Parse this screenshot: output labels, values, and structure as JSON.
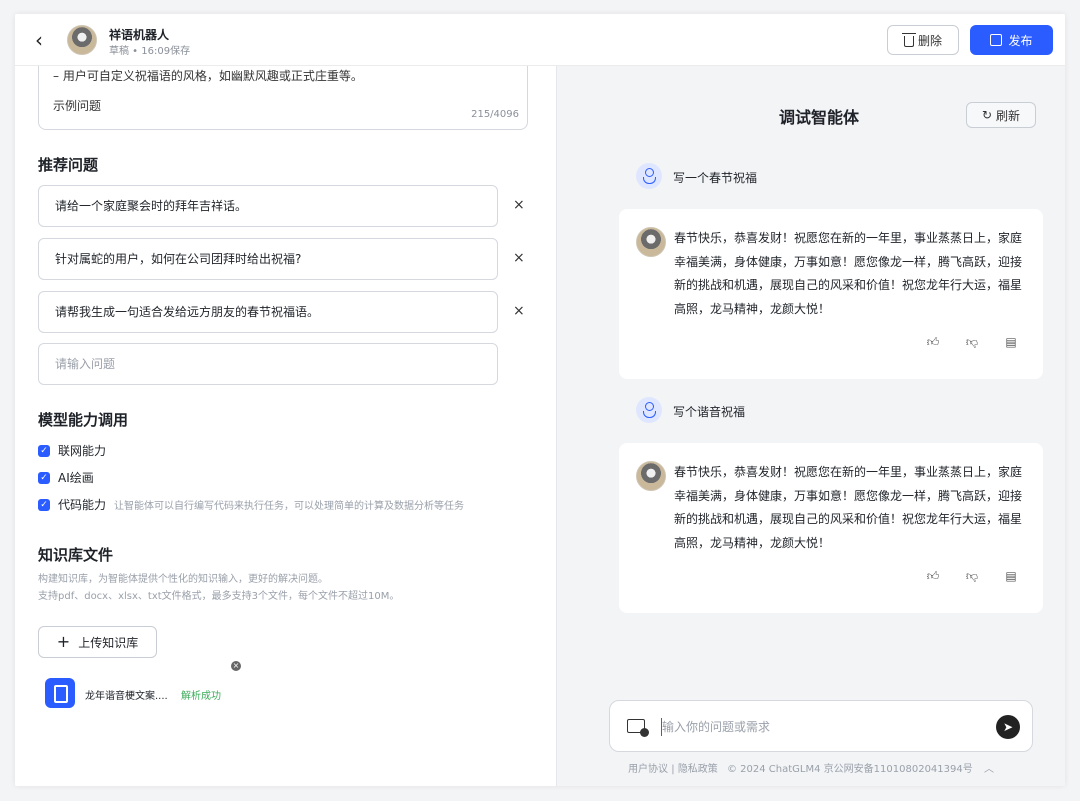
{
  "header": {
    "bot_name": "祥语机器人",
    "status": "草稿 • 16:09保存",
    "delete_label": "删除",
    "publish_label": "发布"
  },
  "prompt_box": {
    "line1": "– 用户可自定义祝福语的风格，如幽默风趣或正式庄重等。",
    "line2": "示例问题",
    "counter": "215/4096"
  },
  "suggested": {
    "title": "推荐问题",
    "items": [
      "请给一个家庭聚会时的拜年吉祥话。",
      "针对属蛇的用户，如何在公司团拜时给出祝福?",
      "请帮我生成一句适合发给远方朋友的春节祝福语。"
    ],
    "remove_glyph": "×",
    "input_placeholder": "请输入问题"
  },
  "capabilities": {
    "title": "模型能力调用",
    "items": [
      {
        "label": "联网能力",
        "desc": ""
      },
      {
        "label": "AI绘画",
        "desc": ""
      },
      {
        "label": "代码能力",
        "desc": "让智能体可以自行编写代码来执行任务，可以处理简单的计算及数据分析等任务"
      }
    ]
  },
  "knowledge": {
    "title": "知识库文件",
    "desc1": "构建知识库，为智能体提供个性化的知识输入，更好的解决问题。",
    "desc2": "支持pdf、docx、xlsx、txt文件格式，最多支持3个文件，每个文件不超过10M。",
    "upload_label": "上传知识库",
    "file_name": "龙年谐音梗文案....",
    "file_status": "解析成功"
  },
  "debug": {
    "title": "调试智能体",
    "refresh_label": "刷新",
    "messages": [
      {
        "user": "写一个春节祝福",
        "bot": "春节快乐，恭喜发财！祝愿您在新的一年里，事业蒸蒸日上，家庭幸福美满，身体健康，万事如意！愿您像龙一样，腾飞高跃，迎接新的挑战和机遇，展现自己的风采和价值！祝您龙年行大运，福星高照，龙马精神，龙颜大悦！"
      },
      {
        "user": "写个谐音祝福",
        "bot": "春节快乐，恭喜发财！祝愿您在新的一年里，事业蒸蒸日上，家庭幸福美满，身体健康，万事如意！愿您像龙一样，腾飞高跃，迎接新的挑战和机遇，展现自己的风采和价值！祝您龙年行大运，福星高照，龙马精神，龙颜大悦！"
      }
    ],
    "input_placeholder": "输入你的问题或需求"
  },
  "footer": {
    "terms": "用户协议",
    "privacy": "隐私政策",
    "copyright": "© 2024 ChatGLM4 京公网安备11010802041394号"
  },
  "colors": {
    "accent": "#2b5cff",
    "success": "#3dab5c",
    "panel_bg": "#f3f4f6"
  }
}
